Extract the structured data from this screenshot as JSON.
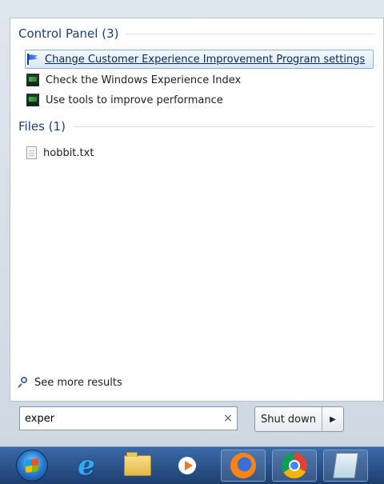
{
  "start_menu": {
    "groups": {
      "control_panel": {
        "header": "Control Panel (3)",
        "items": [
          {
            "label": "Change Customer Experience Improvement Program settings",
            "icon": "flag-icon"
          },
          {
            "label": "Check the Windows Experience Index",
            "icon": "performance-monitor-icon"
          },
          {
            "label": "Use tools to improve performance",
            "icon": "performance-monitor-icon"
          }
        ]
      },
      "files": {
        "header": "Files (1)",
        "items": [
          {
            "label": "hobbit.txt",
            "icon": "text-file-icon"
          }
        ]
      }
    },
    "see_more_label": "See more results",
    "search": {
      "value": "exper",
      "clear_glyph": "×"
    },
    "shutdown": {
      "label": "Shut down",
      "arrow": "▶"
    }
  },
  "taskbar": {
    "items": [
      "start-orb",
      "internet-explorer-icon",
      "file-explorer-icon",
      "media-player-icon",
      "firefox-icon",
      "chrome-icon",
      "notepad-icon"
    ]
  },
  "colors": {
    "group_header": "#1e3f7a",
    "selection_border": "#8fb0d8",
    "taskbar": "#2a5690"
  }
}
